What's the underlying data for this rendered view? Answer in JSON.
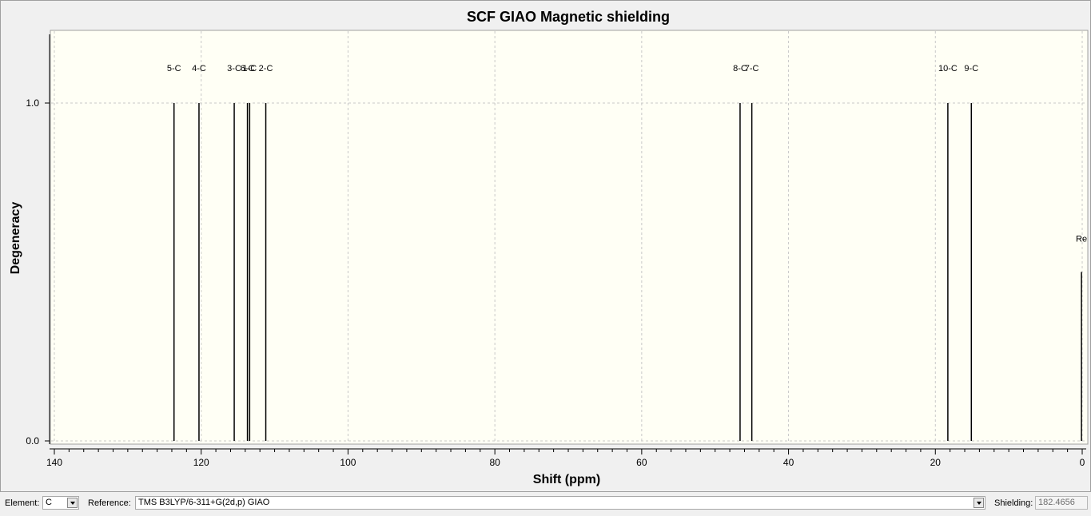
{
  "chart_data": {
    "type": "bar",
    "title": "SCF GIAO Magnetic shielding",
    "xlabel": "Shift (ppm)",
    "ylabel": "Degeneracy",
    "xlim": [
      140,
      0
    ],
    "ylim": [
      0,
      1.2
    ],
    "x_ticks": [
      140,
      120,
      100,
      80,
      60,
      40,
      20,
      0
    ],
    "y_ticks": [
      "0.0",
      "1.0"
    ],
    "grid": true,
    "peaks": [
      {
        "label": "5-C",
        "x": 123.7,
        "y": 1.0
      },
      {
        "label": "4-C",
        "x": 120.3,
        "y": 1.0
      },
      {
        "label": "3-C",
        "x": 115.5,
        "y": 1.0
      },
      {
        "label": "6-C",
        "x": 113.7,
        "y": 1.0
      },
      {
        "label": "1-C",
        "x": 113.4,
        "y": 1.0
      },
      {
        "label": "2-C",
        "x": 111.2,
        "y": 1.0
      },
      {
        "label": "8-C",
        "x": 46.6,
        "y": 1.0
      },
      {
        "label": "7-C",
        "x": 45.0,
        "y": 1.0
      },
      {
        "label": "10-C",
        "x": 18.3,
        "y": 1.0
      },
      {
        "label": "9-C",
        "x": 15.1,
        "y": 1.0
      },
      {
        "label": "Re",
        "x": 0.1,
        "y": 0.5
      }
    ]
  },
  "statusbar": {
    "element_label": "Element:",
    "element_value": "C",
    "reference_label": "Reference:",
    "reference_value": "TMS B3LYP/6-311+G(2d,p) GIAO",
    "shielding_label": "Shielding:",
    "shielding_value": "182.4656"
  },
  "colors": {
    "plot_background": "#fffff5",
    "peak": "#000000",
    "grid": "#c8c8c8"
  }
}
